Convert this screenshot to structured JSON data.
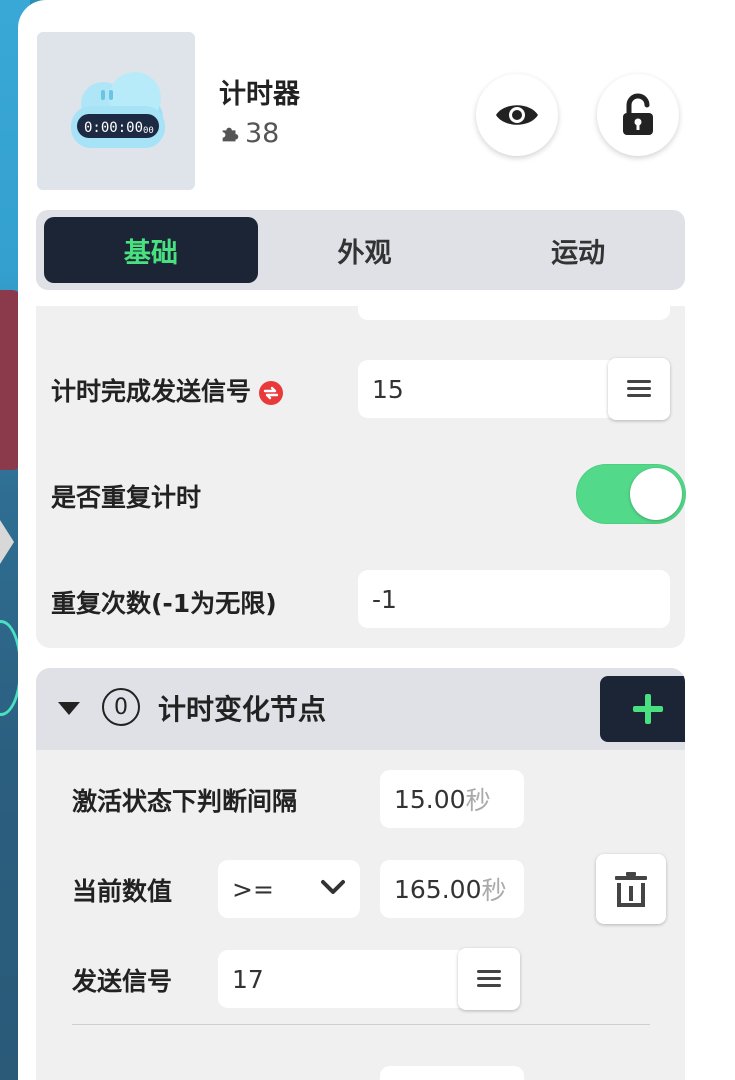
{
  "object": {
    "title": "计时器",
    "count": "38",
    "thumbnail_display": "0:00:00",
    "thumbnail_suffix": "00"
  },
  "tabs": [
    {
      "label": "基础",
      "active": true
    },
    {
      "label": "外观",
      "active": false
    },
    {
      "label": "运动",
      "active": false
    }
  ],
  "basic": {
    "send_signal_label": "计时完成发送信号",
    "send_signal_value": "15",
    "repeat_label": "是否重复计时",
    "repeat_on": true,
    "repeat_count_label": "重复次数(-1为无限)",
    "repeat_count_value": "-1"
  },
  "nodes": {
    "title": "计时变化节点",
    "count": "0",
    "interval_label": "激活状态下判断间隔",
    "interval_value": "15.00",
    "interval_unit": "秒",
    "current_label": "当前数值",
    "operator": ">=",
    "current_value": "165.00",
    "current_unit": "秒",
    "signal_label": "发送信号",
    "signal_value": "17"
  },
  "colors": {
    "accent_green": "#49e07f",
    "dark_navy": "#1c2536",
    "toggle_on": "#53d98a",
    "signal_red": "#e8393b"
  },
  "icons": [
    "eye-icon",
    "unlock-icon",
    "puzzle-icon",
    "signal-icon",
    "hamburger-icon",
    "plus-icon",
    "chevron-down-icon",
    "trash-icon",
    "caret-down-icon"
  ]
}
